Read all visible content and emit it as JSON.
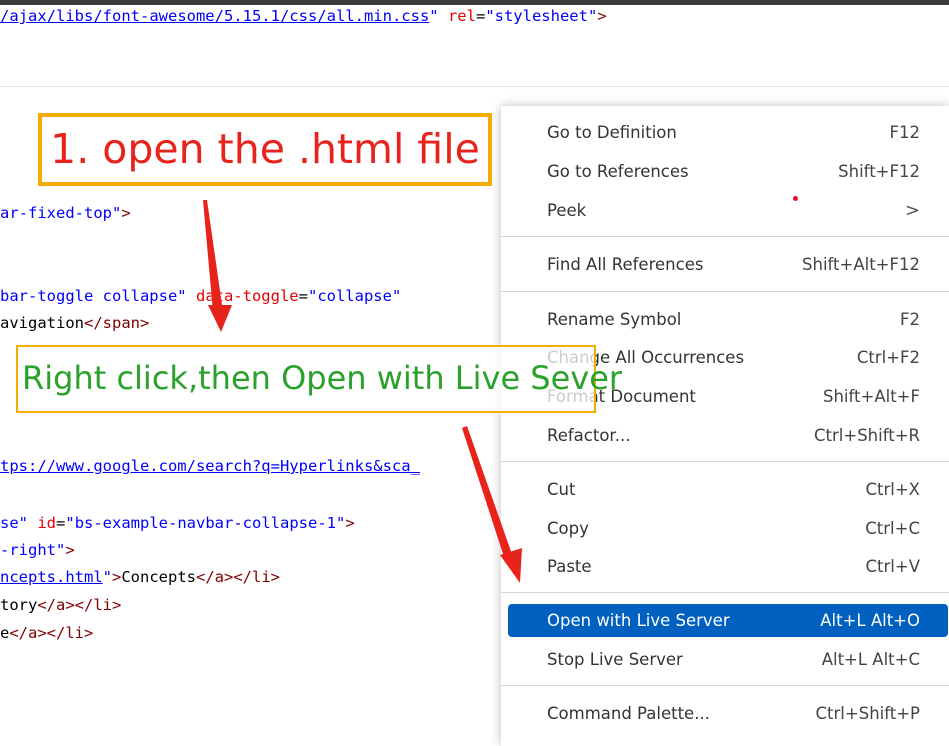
{
  "code": {
    "line_link": {
      "prefix": "/",
      "url": "ajax/libs/font-awesome/5.15.1/css/all.min.css",
      "q1": "\"",
      "rel_attr": "rel",
      "eq": "=",
      "rel_val": "\"stylesheet\"",
      "close": ">"
    },
    "line_navbar": {
      "val": "ar-fixed-top\"",
      "close": ">"
    },
    "line_toggle": {
      "val1": "bar-toggle collapse\"",
      "attr": "data-toggle",
      "eq": "=",
      "val2": "\"collapse\""
    },
    "line_navigation": {
      "text": "avigation",
      "close": "</span>"
    },
    "line_google": {
      "text": "tps://www.google.com/search?q=Hyperlinks&sca_"
    },
    "line_collapse": {
      "val1": "se\"",
      "attr": "id",
      "eq": "=",
      "val2": "\"bs-example-navbar-collapse-1\"",
      "close": ">"
    },
    "line_right": {
      "val": "-right\"",
      "close": ">"
    },
    "line_concepts": {
      "val": "ncepts.html",
      "q": "\"",
      "gt": ">",
      "text": "Concepts",
      "close": "</a></li>"
    },
    "line_history": {
      "text": "tory",
      "close": "</a></li>"
    },
    "line_home": {
      "text": "e",
      "close": "</a></li>"
    }
  },
  "annotations": {
    "step1": "1. open the .html file",
    "step2": "Right click,then Open with Live Sever"
  },
  "menu": {
    "items": [
      {
        "label": "Go to Definition",
        "shortcut": "F12"
      },
      {
        "label": "Go to References",
        "shortcut": "Shift+F12"
      },
      {
        "label": "Peek",
        "shortcut": ">"
      },
      {
        "label": "Find All References",
        "shortcut": "Shift+Alt+F12"
      },
      {
        "label": "Rename Symbol",
        "shortcut": "F2"
      },
      {
        "label": "Change All Occurrences",
        "shortcut": "Ctrl+F2"
      },
      {
        "label": "Format Document",
        "shortcut": "Shift+Alt+F"
      },
      {
        "label": "Refactor...",
        "shortcut": "Ctrl+Shift+R"
      },
      {
        "label": "Cut",
        "shortcut": "Ctrl+X"
      },
      {
        "label": "Copy",
        "shortcut": "Ctrl+C"
      },
      {
        "label": "Paste",
        "shortcut": "Ctrl+V"
      },
      {
        "label": "Open with Live Server",
        "shortcut": "Alt+L Alt+O"
      },
      {
        "label": "Stop Live Server",
        "shortcut": "Alt+L Alt+C"
      },
      {
        "label": "Command Palette...",
        "shortcut": "Ctrl+Shift+P"
      }
    ]
  },
  "colors": {
    "accent": "#0060c0",
    "annotation_border": "#f2ad00",
    "annotation_red": "#e8231c",
    "annotation_green": "#2aa12a",
    "arrow": "#e8231c"
  },
  "icons": {
    "peek_submenu": "chevron-right-icon",
    "arrow": "pointer-arrow-icon"
  }
}
